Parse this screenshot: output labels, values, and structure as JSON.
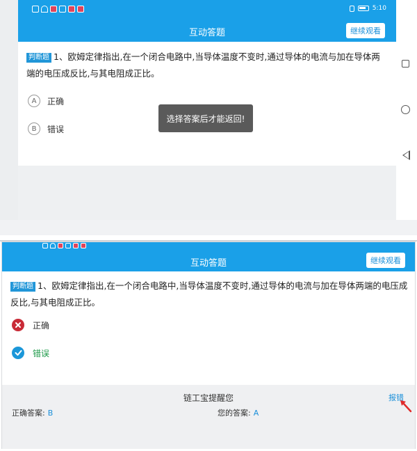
{
  "top_screen": {
    "status_time": "5:10",
    "title": "互动答题",
    "continue_label": "继续观看",
    "question": {
      "tag": "判断题",
      "text": "1、欧姆定律指出,在一个闭合电路中,当导体温度不变时,通过导体的电流与加在导体两端的电压成反比,与其电阻成正比。"
    },
    "options": [
      {
        "letter": "A",
        "label": "正确"
      },
      {
        "letter": "B",
        "label": "错误"
      }
    ],
    "toast": "选择答案后才能返回!",
    "nav_icons": [
      "recent-apps-icon",
      "home-icon",
      "back-icon"
    ]
  },
  "bottom_screen": {
    "title": "互动答题",
    "continue_label": "继续观看",
    "question": {
      "tag": "判断题",
      "text": "1、欧姆定律指出,在一个闭合电路中,当导体温度不变时,通过导体的电流与加在导体两端的电压成反比,与其电阻成正比。"
    },
    "options": [
      {
        "label": "正确",
        "state": "wrong",
        "icon": "wrong-cross-icon"
      },
      {
        "label": "错误",
        "state": "correct",
        "icon": "correct-check-icon"
      }
    ],
    "feedback": {
      "title": "链工宝提醒您",
      "report_label": "报错",
      "correct_answer_label": "正确答案:",
      "correct_answer_value": "B",
      "your_answer_label": "您的答案:",
      "your_answer_value": "A"
    }
  },
  "colors": {
    "brand_blue": "#1aa0e8",
    "wrong_red": "#c92b37",
    "correct_blue": "#1b97d9",
    "correct_text_green": "#1f9a4a"
  }
}
